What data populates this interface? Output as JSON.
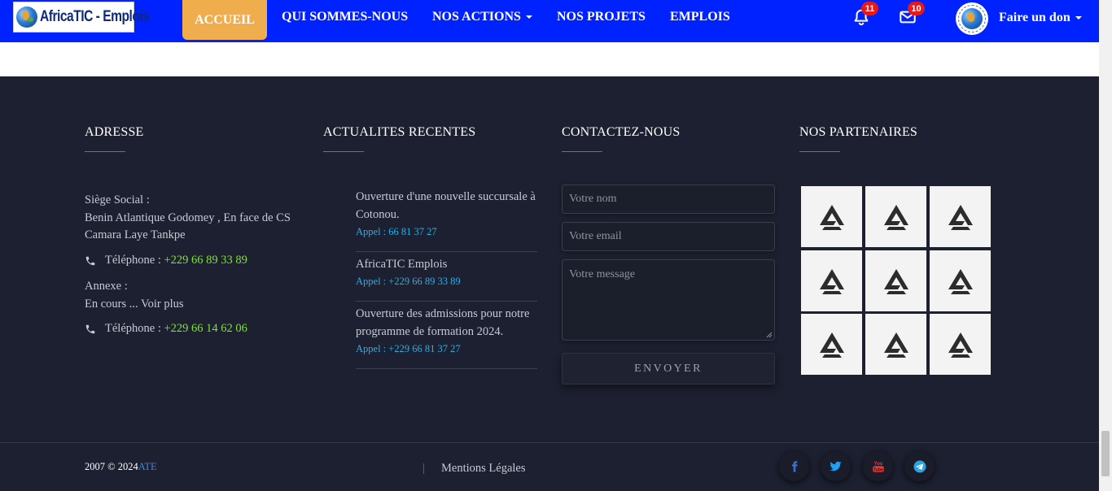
{
  "navbar": {
    "logo_text": "AfricaTIC - Emplois",
    "items": [
      {
        "label": "ACCUEIL"
      },
      {
        "label": "QUI SOMMES-NOUS"
      },
      {
        "label": "NOS ACTIONS"
      },
      {
        "label": "NOS PROJETS"
      },
      {
        "label": "EMPLOIS"
      }
    ],
    "notifications_count": "11",
    "messages_count": "10",
    "donate_label": "Faire un don",
    "colors": {
      "bar": "#0022ff",
      "active": "#f0ad4e",
      "badge": "#e81818"
    },
    "icons": [
      "bell-icon",
      "envelope-icon",
      "chevron-down-icon"
    ]
  },
  "footer": {
    "address": {
      "title": "ADRESSE",
      "hq_label": "Siège Social :",
      "hq_line1": "Benin Atlantique Godomey , En face de CS",
      "hq_line2": "Camara Laye Tankpe",
      "phone1_label": "Téléphone : ",
      "phone1_value": "+229 66 89 33 89",
      "annex_label": "Annexe :",
      "annex_value": "En cours ... Voir plus",
      "phone2_label": "Téléphone : ",
      "phone2_value": "+229 66 14 62 06"
    },
    "news": {
      "title": "ACTUALITES RECENTES",
      "items": [
        {
          "title": "Ouverture d'une nouvelle succursale à Cotonou.",
          "phone": "Appel : 66 81 37 27"
        },
        {
          "title": "AfricaTIC Emplois",
          "phone": "Appel : +229 66 89 33 89"
        },
        {
          "title": "Ouverture des admissions pour notre programme de formation 2024.",
          "phone": "Appel : +229 66 81 37 27"
        }
      ]
    },
    "contact": {
      "title": "CONTACTEZ-NOUS",
      "name_placeholder": "Votre nom",
      "email_placeholder": "Votre email",
      "message_placeholder": "Votre message",
      "send_label": "ENVOYER"
    },
    "partners": {
      "title": "NOS PARTENAIRES",
      "tile_icon": "partner-logo-icon"
    },
    "bottom": {
      "copyright": "2007 © 2024",
      "copyright_link": "ATE",
      "mentions": "Mentions Légales",
      "social_icons": [
        "facebook-icon",
        "twitter-icon",
        "youtube-icon",
        "telegram-icon"
      ]
    },
    "colors": {
      "background": "#1d2030",
      "phone_green": "#7de52e",
      "news_phone": "#2bb0e6"
    }
  }
}
